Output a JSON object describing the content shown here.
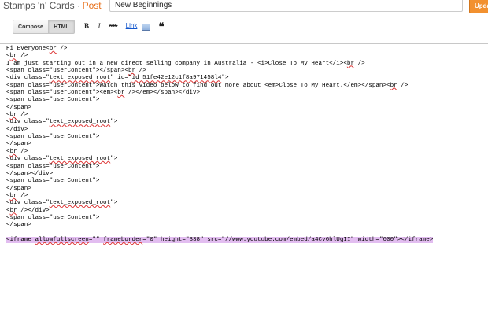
{
  "header": {
    "blog_name": "Stamps 'n' Cards",
    "separator": "·",
    "section": "Post",
    "post_title": "New Beginnings",
    "update_label": "Upda"
  },
  "toolbar": {
    "compose_label": "Compose",
    "html_label": "HTML",
    "bold_label": "B",
    "italic_label": "I",
    "strike_label": "ABC",
    "link_label": "Link",
    "quote_label": "❝"
  },
  "editor": {
    "lines": [
      "Hi Everyone<br />",
      "<br />",
      "I am just starting out in a new direct selling company in Australia - <i>Close To My Heart</i><br />",
      "<span class=\"userContent\"></span><br />",
      "<div class=\"text_exposed_root\" id=\"id_51fe42e12c1f8a971458l4\">",
      "<span class=\"userContent\">Watch this video below to find out more about <em>Close To My Heart.</em></span><br />",
      "<span class=\"userContent\"><em><br /></em></span></div>",
      "<span class=\"userContent\">",
      "</span>",
      "<br />",
      "<div class=\"text_exposed_root\">",
      "</div>",
      "<span class=\"userContent\">",
      "</span>",
      "<br />",
      "<div class=\"text_exposed_root\">",
      "<span class=\"userContent\">",
      "</span></div>",
      "<span class=\"userContent\">",
      "</span>",
      "<br />",
      "<div class=\"text_exposed_root\">",
      "<br /></div>",
      "<span class=\"userContent\">",
      "</span>",
      "",
      "<iframe allowfullscreen=\"\" frameborder=\"0\" height=\"338\" src=\"//www.youtube.com/embed/a4Cv6hlUgII\" width=\"600\"></iframe>"
    ],
    "highlighted_line": 26
  }
}
